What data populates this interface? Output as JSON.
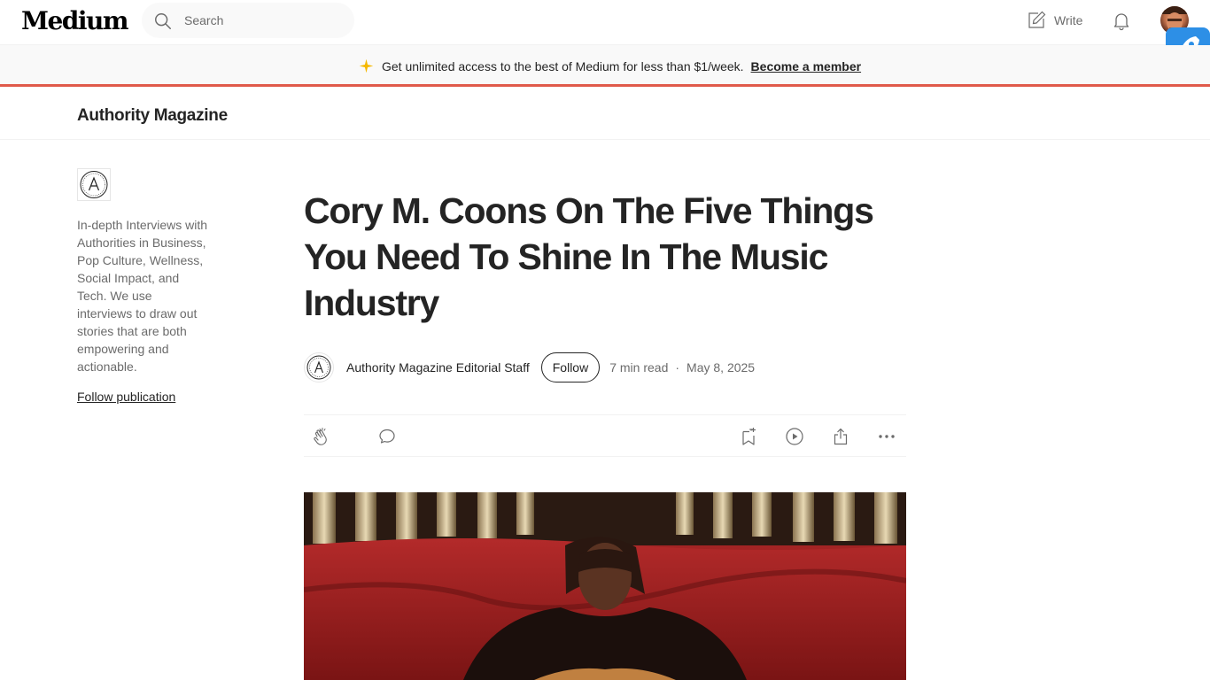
{
  "header": {
    "logo": "Medium",
    "search_placeholder": "Search",
    "write_label": "Write"
  },
  "banner": {
    "text": "Get unlimited access to the best of Medium for less than $1/week.",
    "link": "Become a member",
    "accent_color": "#f5b800",
    "border_color": "#e05a4a"
  },
  "publication": {
    "name": "Authority Magazine",
    "description": "In-depth Interviews with Authorities in Business, Pop Culture, Wellness, Social Impact, and Tech. We use interviews to draw out stories that are both empowering and actionable.",
    "follow_label": "Follow publication"
  },
  "article": {
    "title": "Cory M. Coons On The Five Things You Need To Shine In The Music Industry",
    "author": "Authority Magazine Editorial Staff",
    "follow_label": "Follow",
    "read_time": "7 min read",
    "separator": "·",
    "date": "May 8, 2025"
  },
  "icons": {
    "search": "search-icon",
    "write": "write-icon",
    "notifications": "bell-icon",
    "clap": "clap-icon",
    "responses": "comment-icon",
    "save": "bookmark-add-icon",
    "listen": "play-icon",
    "share": "share-icon",
    "more": "more-icon",
    "extension": "rocket-icon"
  }
}
